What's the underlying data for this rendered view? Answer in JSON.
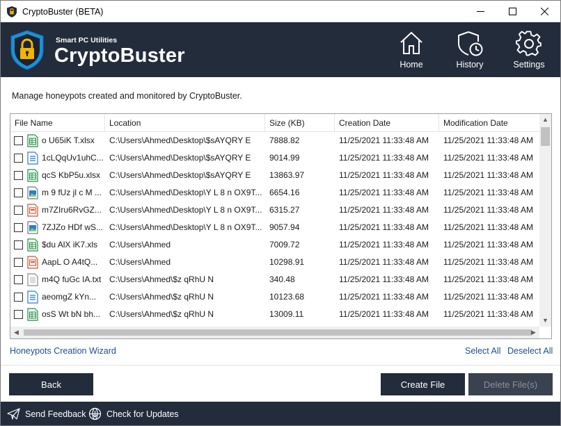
{
  "window": {
    "title": "CryptoBuster (BETA)"
  },
  "header": {
    "brand_sub": "Smart PC Utilities",
    "brand_name": "CryptoBuster",
    "nav": [
      {
        "label": "Home",
        "icon": "home-icon"
      },
      {
        "label": "History",
        "icon": "history-icon"
      },
      {
        "label": "Settings",
        "icon": "gear-icon"
      }
    ]
  },
  "description": "Manage honeypots created and monitored by CryptoBuster.",
  "table": {
    "columns": [
      "File Name",
      "Location",
      "Size (KB)",
      "Creation Date",
      "Modification Date"
    ],
    "rows": [
      {
        "type": "xlsx",
        "name": "o U65iK T.xlsx",
        "location": "C:\\Users\\Ahmed\\Desktop\\$sAYQRY E",
        "size": "7888.82",
        "created": "11/25/2021 11:33:48 AM",
        "modified": "11/25/2021 11:33:48 AM"
      },
      {
        "type": "doc",
        "name": "1cLQqUv1uhC...",
        "location": "C:\\Users\\Ahmed\\Desktop\\$sAYQRY E",
        "size": "9014.99",
        "created": "11/25/2021 11:33:48 AM",
        "modified": "11/25/2021 11:33:48 AM"
      },
      {
        "type": "xlsx",
        "name": "qcS KbP5u.xlsx",
        "location": "C:\\Users\\Ahmed\\Desktop\\$sAYQRY E",
        "size": "13863.97",
        "created": "11/25/2021 11:33:48 AM",
        "modified": "11/25/2021 11:33:48 AM"
      },
      {
        "type": "img",
        "name": "m 9 fUz jl c M ...",
        "location": "C:\\Users\\Ahmed\\Desktop\\Y L 8 n OX9T...",
        "size": "6654.16",
        "created": "11/25/2021 11:33:48 AM",
        "modified": "11/25/2021 11:33:48 AM"
      },
      {
        "type": "ppt",
        "name": "m7ZIru6RvGZ...",
        "location": "C:\\Users\\Ahmed\\Desktop\\Y L 8 n OX9T...",
        "size": "6315.27",
        "created": "11/25/2021 11:33:48 AM",
        "modified": "11/25/2021 11:33:48 AM"
      },
      {
        "type": "img",
        "name": "7ZJZo HDf wS...",
        "location": "C:\\Users\\Ahmed\\Desktop\\Y L 8 n OX9T...",
        "size": "9057.94",
        "created": "11/25/2021 11:33:48 AM",
        "modified": "11/25/2021 11:33:48 AM"
      },
      {
        "type": "xlsx",
        "name": "$du AlX iK7.xls",
        "location": "C:\\Users\\Ahmed",
        "size": "7009.72",
        "created": "11/25/2021 11:33:48 AM",
        "modified": "11/25/2021 11:33:48 AM"
      },
      {
        "type": "ppt",
        "name": "AapL O A4tQ...",
        "location": "C:\\Users\\Ahmed",
        "size": "10298.91",
        "created": "11/25/2021 11:33:48 AM",
        "modified": "11/25/2021 11:33:48 AM"
      },
      {
        "type": "txt",
        "name": "m4Q fuGc IA.txt",
        "location": "C:\\Users\\Ahmed\\$z qRhU N",
        "size": "340.48",
        "created": "11/25/2021 11:33:48 AM",
        "modified": "11/25/2021 11:33:48 AM"
      },
      {
        "type": "doc",
        "name": "aeomgZ kYn...",
        "location": "C:\\Users\\Ahmed\\$z qRhU N",
        "size": "10123.68",
        "created": "11/25/2021 11:33:48 AM",
        "modified": "11/25/2021 11:33:48 AM"
      },
      {
        "type": "xlsx",
        "name": "osS Wt bN bh...",
        "location": "C:\\Users\\Ahmed\\$z qRhU N",
        "size": "13009.11",
        "created": "11/25/2021 11:33:48 AM",
        "modified": "11/25/2021 11:33:48 AM"
      }
    ]
  },
  "links": {
    "wizard": "Honeypots Creation Wizard",
    "select_all": "Select All",
    "deselect_all": "Deselect All"
  },
  "buttons": {
    "back": "Back",
    "create": "Create File",
    "delete": "Delete File(s)"
  },
  "footer": {
    "feedback": "Send Feedback",
    "updates": "Check for Updates"
  },
  "colors": {
    "header_bg": "#232c3b",
    "link": "#1d4f91",
    "excel_green": "#1e8e3e",
    "word_blue": "#2b7cd3",
    "ppt_orange": "#d35230"
  }
}
